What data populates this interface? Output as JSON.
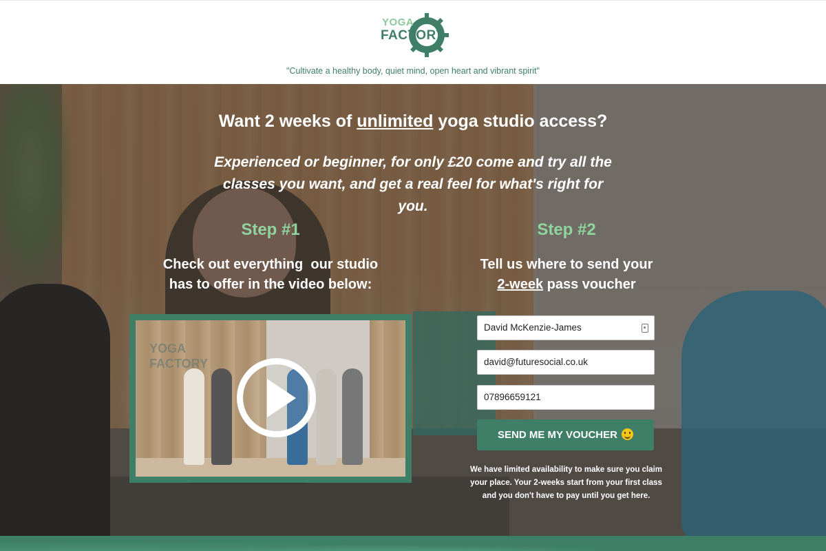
{
  "header": {
    "logo": {
      "line1": "YOGA",
      "line2": "FACTORY"
    },
    "tagline": "\"Cultivate a healthy body, quiet mind, open heart and vibrant spirit\""
  },
  "hero": {
    "headline_pre": "Want 2 weeks of ",
    "headline_underline": "unlimited",
    "headline_post": " yoga studio access?",
    "subhead": "Experienced or beginner, for only £20 come and try all the classes you want, and get a real feel for what's right for you."
  },
  "step1": {
    "title": "Step #1",
    "text_line1": "Check out everything  our studio",
    "text_line2": "has to offer in the video below:"
  },
  "video": {
    "logo_line1": "YOGA",
    "logo_line2": "FACTORY",
    "play_icon": "play-icon"
  },
  "step2": {
    "title": "Step #2",
    "text_line1": "Tell us where to send your",
    "text_underline": "2-week",
    "text_line2_post": " pass voucher"
  },
  "form": {
    "name_value": "David McKenzie-James",
    "email_value": "david@futuresocial.co.uk",
    "phone_value": "07896659121",
    "submit_label": "SEND ME MY VOUCHER",
    "submit_icon": "smiley-emoji-icon",
    "disclaimer": "We have limited availability to make sure you claim your place. Your 2-weeks start from your first class and you don't have to pay until you get here."
  },
  "colors": {
    "brand_green": "#3f7f68",
    "step_green": "#8fd49e",
    "logo_light_green": "#8fc79c"
  }
}
